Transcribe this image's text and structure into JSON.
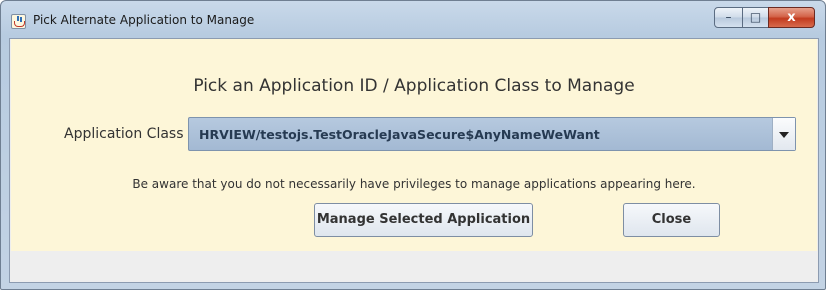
{
  "window": {
    "title": "Pick Alternate Application to Manage",
    "controls": {
      "minimize": "–",
      "maximize": "□",
      "close": "x"
    }
  },
  "dialog": {
    "heading": "Pick an Application ID / Application Class to Manage",
    "application_class_label": "Application Class",
    "application_class_value": "HRVIEW/testojs.TestOracleJavaSecure$AnyNameWeWant",
    "notice": "Be aware that you do not necessarily have privileges to manage applications appearing here.",
    "manage_button": "Manage Selected Application",
    "close_button": "Close"
  },
  "icons": {
    "app": "java-icon",
    "dropdown": "chevron-down-icon"
  }
}
